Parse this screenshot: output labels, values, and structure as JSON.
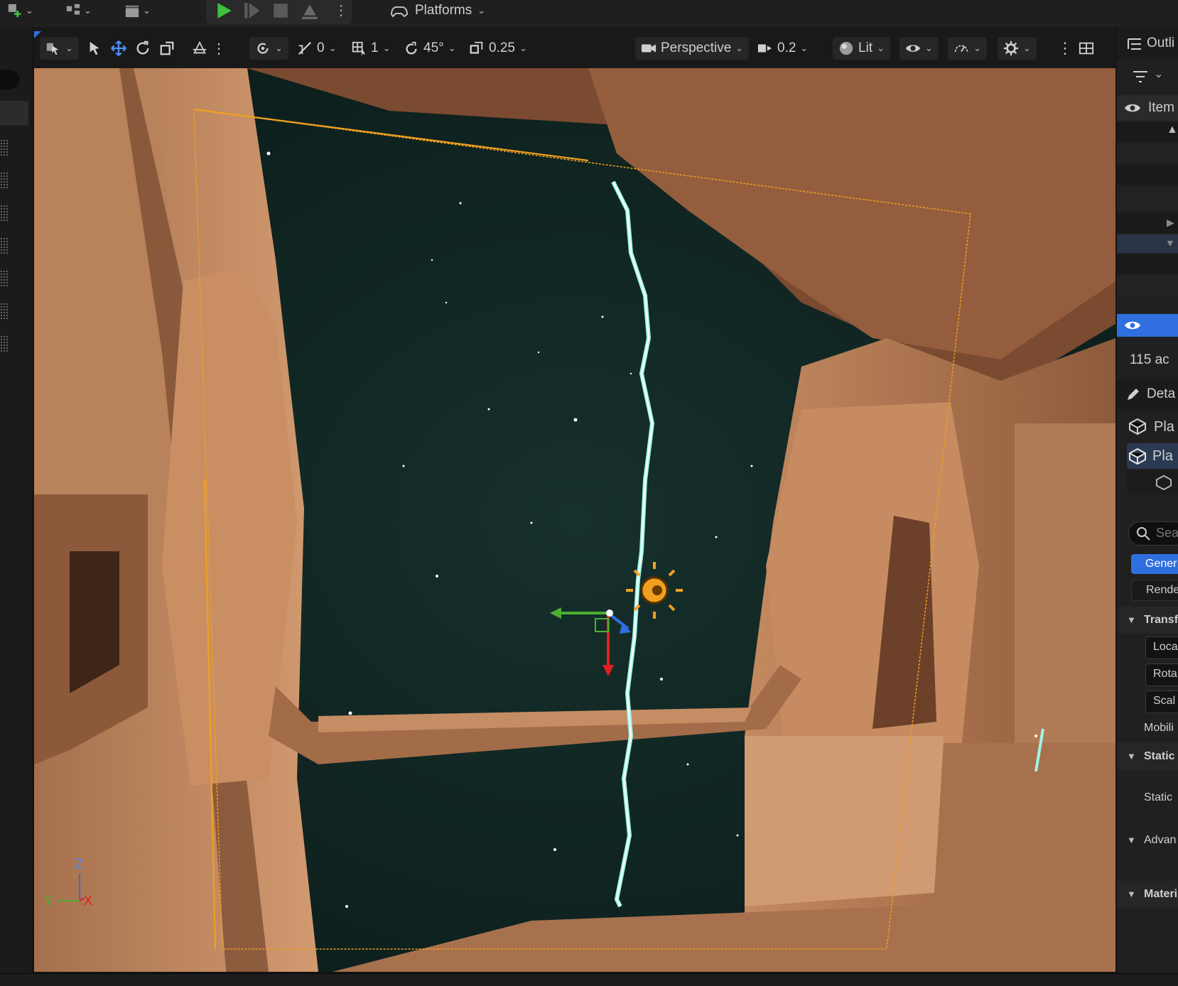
{
  "toolbar": {
    "platforms_label": "Platforms"
  },
  "viewport_toolbar": {
    "translate_snap": "0",
    "grid_snap": "1",
    "rotation_snap": "45°",
    "scale_snap": "0.25",
    "view_mode": "Perspective",
    "camera_speed": "0.2",
    "lighting_mode": "Lit"
  },
  "axis_indicator": {
    "z": "Z",
    "y": "Y",
    "x": "X"
  },
  "outliner": {
    "title": "Outli",
    "column_item": "Item",
    "actor_count": "115 ac"
  },
  "details": {
    "title": "Deta",
    "actor_row": "Pla",
    "component_row": "Pla",
    "search_placeholder": "Sea",
    "tab_general": "Gener",
    "tab_rendering": "Rende",
    "section_transform": "Transf",
    "location_label": "Loca",
    "rotation_label": "Rota",
    "scale_label": "Scal",
    "mobility_label": "Mobili",
    "section_static": "Static",
    "static_mesh_label": "Static",
    "section_advanced": "Advan",
    "section_materials": "Materi"
  },
  "colors": {
    "accent_blue": "#2f6fe0",
    "play_green": "#3ec23e",
    "selection_orange": "#f0a020",
    "beam_cyan": "#9ff5e6"
  }
}
